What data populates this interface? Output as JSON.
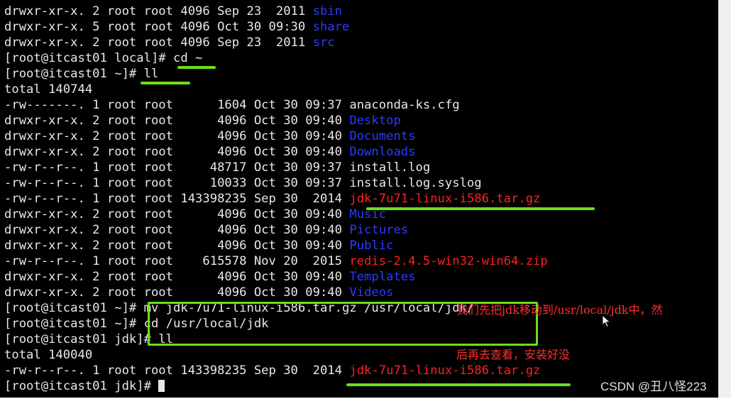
{
  "terminal": {
    "lines": [
      {
        "meta": "drwxr-xr-x. 2 root root 4096 Sep 23  2011 ",
        "name": "sbin",
        "kind": "dir"
      },
      {
        "meta": "drwxr-xr-x. 5 root root 4096 Oct 30 09:30 ",
        "name": "share",
        "kind": "dir"
      },
      {
        "meta": "drwxr-xr-x. 2 root root 4096 Sep 23  2011 ",
        "name": "src",
        "kind": "dir"
      },
      {
        "meta": "[root@itcast01 local]# cd ~",
        "name": "",
        "kind": "prompt"
      },
      {
        "meta": "[root@itcast01 ~]# ll",
        "name": "",
        "kind": "prompt"
      },
      {
        "meta": "total 140744",
        "name": "",
        "kind": "text"
      },
      {
        "meta": "-rw-------. 1 root root      1604 Oct 30 09:37 ",
        "name": "anaconda-ks.cfg",
        "kind": "file"
      },
      {
        "meta": "drwxr-xr-x. 2 root root      4096 Oct 30 09:40 ",
        "name": "Desktop",
        "kind": "dir"
      },
      {
        "meta": "drwxr-xr-x. 2 root root      4096 Oct 30 09:40 ",
        "name": "Documents",
        "kind": "dir"
      },
      {
        "meta": "drwxr-xr-x. 2 root root      4096 Oct 30 09:40 ",
        "name": "Downloads",
        "kind": "dir"
      },
      {
        "meta": "-rw-r--r--. 1 root root     48717 Oct 30 09:37 ",
        "name": "install.log",
        "kind": "file"
      },
      {
        "meta": "-rw-r--r--. 1 root root     10033 Oct 30 09:37 ",
        "name": "install.log.syslog",
        "kind": "file"
      },
      {
        "meta": "-rw-r--r--. 1 root root 143398235 Sep 30  2014 ",
        "name": "jdk-7u71-linux-i586.tar.gz",
        "kind": "archive"
      },
      {
        "meta": "drwxr-xr-x. 2 root root      4096 Oct 30 09:40 ",
        "name": "Music",
        "kind": "dir"
      },
      {
        "meta": "drwxr-xr-x. 2 root root      4096 Oct 30 09:40 ",
        "name": "Pictures",
        "kind": "dir"
      },
      {
        "meta": "drwxr-xr-x. 2 root root      4096 Oct 30 09:40 ",
        "name": "Public",
        "kind": "dir"
      },
      {
        "meta": "-rw-r--r--. 1 root root    615578 Nov 20  2015 ",
        "name": "redis-2.4.5-win32-win64.zip",
        "kind": "archive"
      },
      {
        "meta": "drwxr-xr-x. 2 root root      4096 Oct 30 09:40 ",
        "name": "Templates",
        "kind": "dir"
      },
      {
        "meta": "drwxr-xr-x. 2 root root      4096 Oct 30 09:40 ",
        "name": "Videos",
        "kind": "dir"
      },
      {
        "meta": "[root@itcast01 ~]# mv jdk-7u71-linux-i586.tar.gz /usr/local/jdk/",
        "name": "",
        "kind": "prompt"
      },
      {
        "meta": "[root@itcast01 ~]# cd /usr/local/jdk",
        "name": "",
        "kind": "prompt"
      },
      {
        "meta": "[root@itcast01 jdk]# ll",
        "name": "",
        "kind": "prompt"
      },
      {
        "meta": "total 140040",
        "name": "",
        "kind": "text"
      },
      {
        "meta": "-rw-r--r--. 1 root root 143398235 Sep 30  2014 ",
        "name": "jdk-7u71-linux-i586.tar.gz",
        "kind": "archive"
      },
      {
        "meta": "[root@itcast01 jdk]# ",
        "name": "",
        "kind": "prompt"
      }
    ]
  },
  "annotation": {
    "line1": "我们先把jdk移动到/usr/local/jdk中，然",
    "line2": "后再去查看，安装好没"
  },
  "watermark": "CSDN @丑八怪223",
  "colors": {
    "background": "#000000",
    "text": "#e8e8e8",
    "directory": "#2a3bff",
    "archive": "#ff2020",
    "highlight": "#6cde1a",
    "annotation": "#ff3030"
  }
}
